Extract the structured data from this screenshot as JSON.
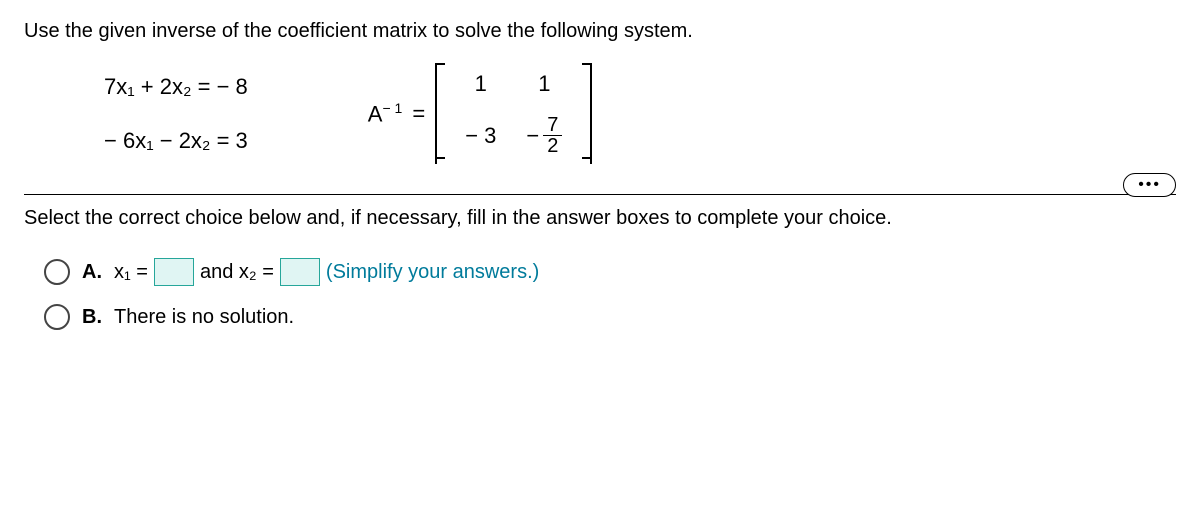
{
  "question": "Use the given inverse of the coefficient matrix to solve the following system.",
  "equation1": "7x₁ + 2x₂  =  − 8",
  "equation2": "− 6x₁ − 2x₂  =  3",
  "matrix_label_base": "A",
  "matrix_label_exp": "− 1",
  "equals": "=",
  "matrix": {
    "r1c1": "1",
    "r1c2": "1",
    "r2c1": "− 3",
    "r2c2_sign": "−",
    "r2c2_num": "7",
    "r2c2_den": "2"
  },
  "dots": "•••",
  "instruction": "Select the correct choice below and, if necessary, fill in the answer boxes to complete your choice.",
  "choiceA": {
    "label": "A.",
    "x1pre": "x₁ =",
    "and": " and x₂ =",
    "simplify": " (Simplify your answers.)"
  },
  "choiceB": {
    "label": "B.",
    "text": "There is no solution."
  }
}
